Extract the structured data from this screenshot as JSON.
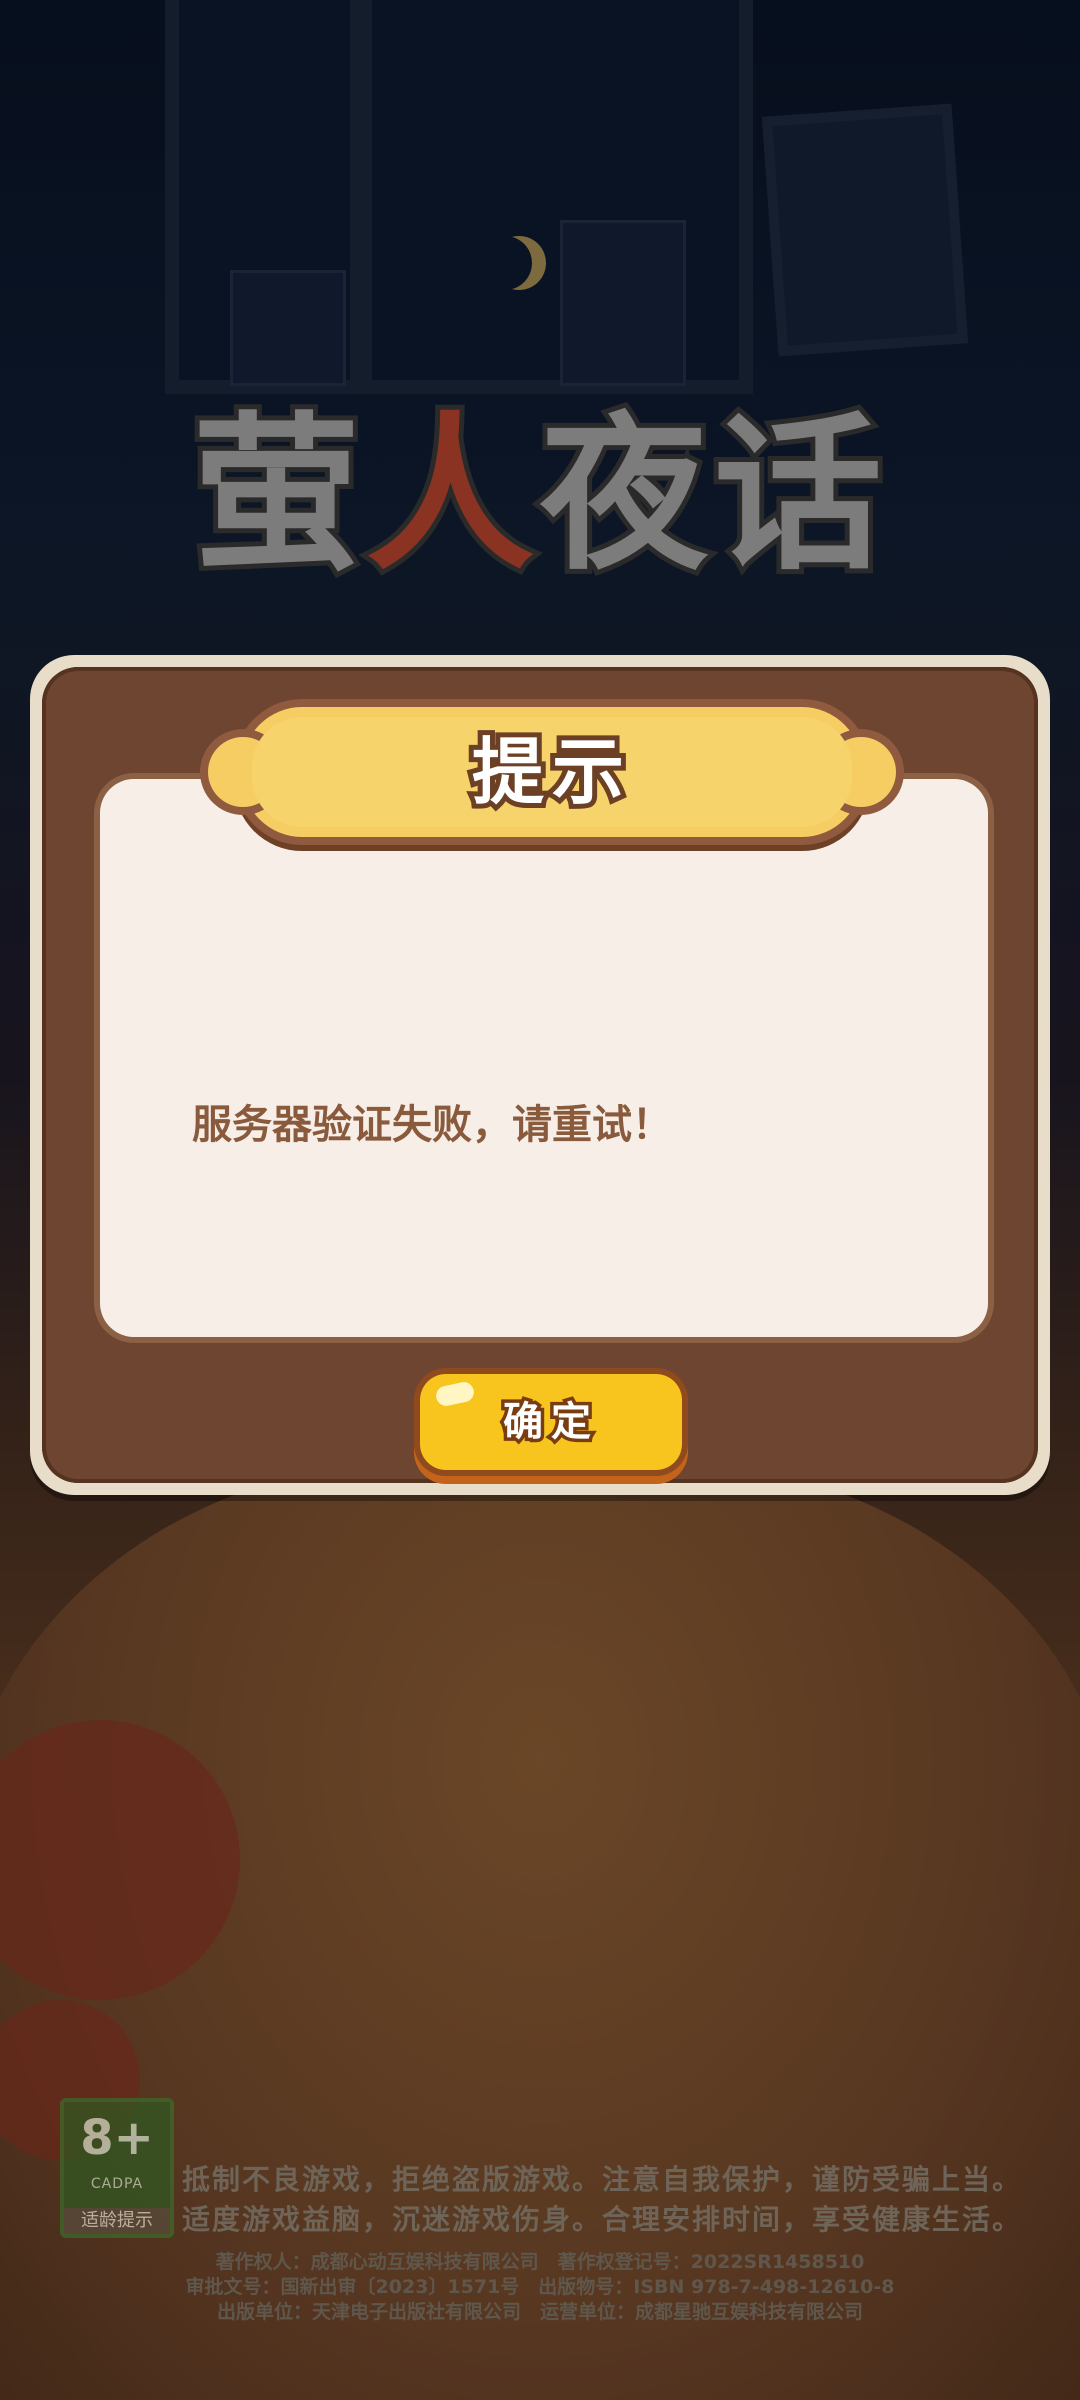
{
  "game": {
    "logo_text_part1": "萤",
    "logo_text_accent": "人",
    "logo_text_part2": "夜话"
  },
  "dialog": {
    "title": "提示",
    "message": "服务器验证失败，请重试！",
    "confirm_label": "确定"
  },
  "age_rating": {
    "value": "8+",
    "org": "CADPA",
    "label": "适龄提示"
  },
  "footer": {
    "notice_line1": "抵制不良游戏，拒绝盗版游戏。注意自我保护，谨防受骗上当。",
    "notice_line2": "适度游戏益脑，沉迷游戏伤身。合理安排时间，享受健康生活。",
    "credits_line1": "著作权人：成都心动互娱科技有限公司　著作权登记号：2022SR1458510",
    "credits_line2": "审批文号：国新出审〔2023〕1571号　出版物号：ISBN 978-7-498-12610-8",
    "credits_line3": "出版单位：天津电子出版社有限公司　运营单位：成都星驰互娱科技有限公司"
  },
  "colors": {
    "dialog_brown": "#6d4530",
    "panel_cream": "#f7efe7",
    "banner_yellow": "#f5cd62",
    "button_yellow": "#f8c51f",
    "message_text": "#8a5a3d"
  }
}
